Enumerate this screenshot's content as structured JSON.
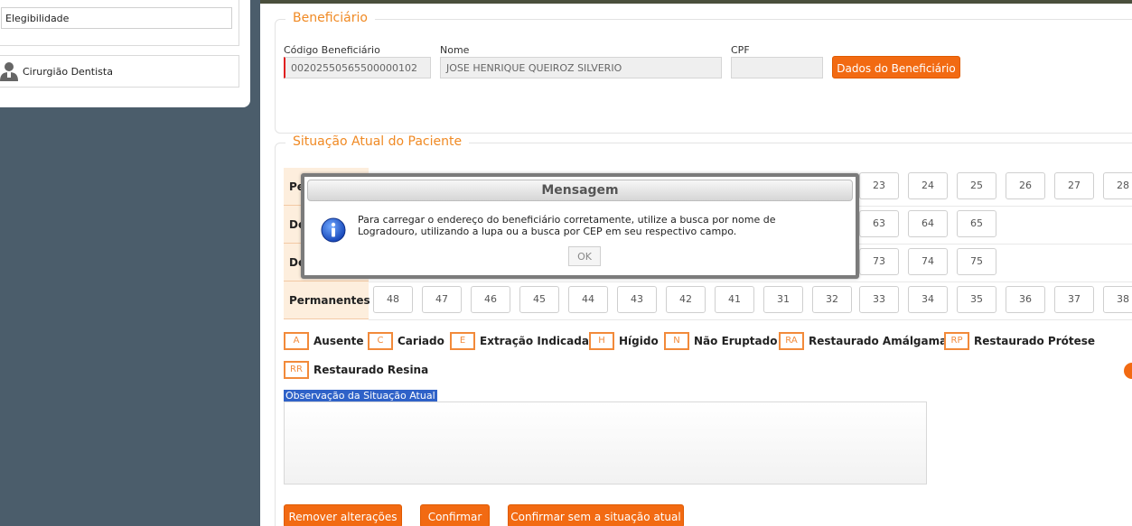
{
  "sidebar": {
    "item_elegibilidade": "Elegibilidade",
    "item_cirurgiao": "Cirurgião Dentista"
  },
  "beneficiario": {
    "title": "Beneficiário",
    "codigo_label": "Código Beneficiário",
    "codigo_value": "00202550565500000102",
    "nome_label": "Nome",
    "nome_value": "JOSE HENRIQUE QUEIROZ SILVERIO",
    "cpf_label": "CPF",
    "cpf_value": "",
    "dados_button": "Dados do Beneficiário"
  },
  "situacao": {
    "title": "Situação Atual do Paciente",
    "rows": [
      {
        "label": "Pe",
        "teeth": [
          "23",
          "24",
          "25",
          "26",
          "27",
          "28"
        ]
      },
      {
        "label": "De",
        "teeth": [
          "63",
          "64",
          "65"
        ]
      },
      {
        "label": "De",
        "teeth": [
          "73",
          "74",
          "75"
        ]
      },
      {
        "label": "Permanentes",
        "teeth": [
          "48",
          "47",
          "46",
          "45",
          "44",
          "43",
          "42",
          "41",
          "31",
          "32",
          "33",
          "34",
          "35",
          "36",
          "37",
          "38"
        ]
      }
    ]
  },
  "legend": [
    {
      "code": "A",
      "label": "Ausente"
    },
    {
      "code": "C",
      "label": "Cariado"
    },
    {
      "code": "E",
      "label": "Extração Indicada"
    },
    {
      "code": "H",
      "label": "Hígido"
    },
    {
      "code": "N",
      "label": "Não Eruptado"
    },
    {
      "code": "RA",
      "label": "Restaurado Amálgama"
    },
    {
      "code": "RP",
      "label": "Restaurado Prótese"
    },
    {
      "code": "RR",
      "label": "Restaurado Resina"
    }
  ],
  "observacao": {
    "label": "Observação da Situação Atual",
    "value": ""
  },
  "actions": {
    "remover": "Remover alterações",
    "confirmar": "Confirmar",
    "confirmar_sem": "Confirmar sem a situação atual"
  },
  "modal": {
    "title": "Mensagem",
    "message": "Para carregar o endereço do beneficiário corretamente, utilize a busca por nome de Logradouro, utilizando a lupa ou a busca por CEP em seu respectivo campo.",
    "ok": "OK"
  },
  "icons": {
    "person": "person-icon",
    "info": "info-icon"
  },
  "colors": {
    "accent": "#f26a12",
    "section_title": "#f08a24",
    "sidebar_bg": "#4b5d6b"
  }
}
